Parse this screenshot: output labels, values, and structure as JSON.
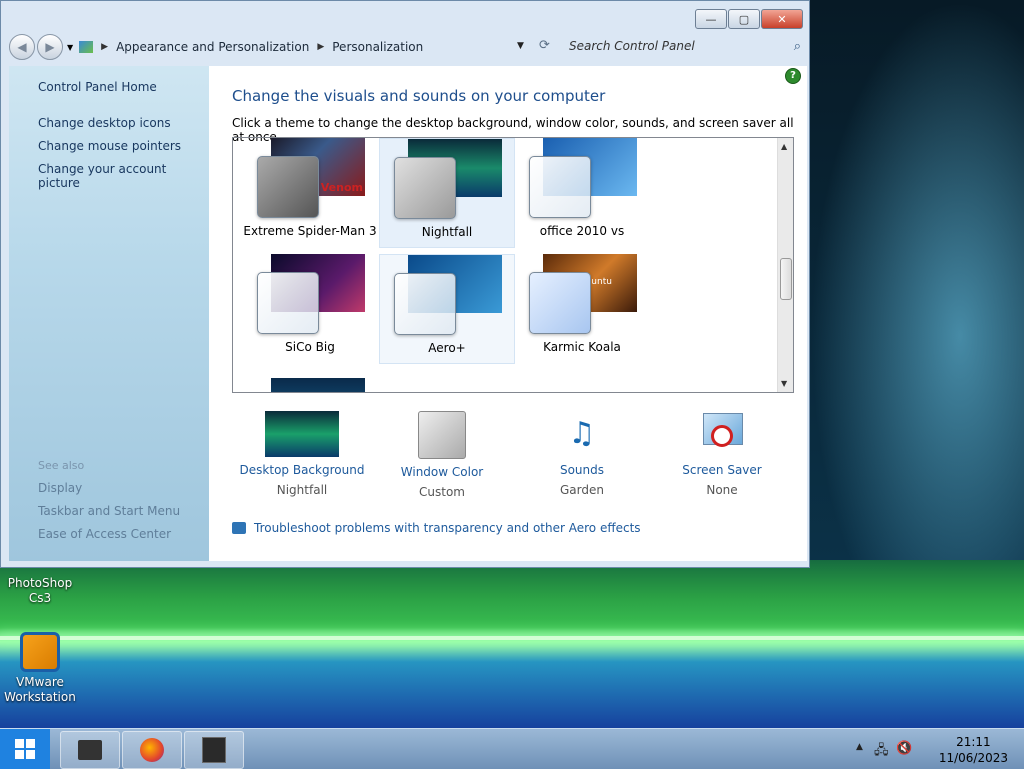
{
  "window": {
    "controls": {
      "minimize": "—",
      "maximize": "▢",
      "close": "✕"
    },
    "breadcrumb": [
      "Appearance and Personalization",
      "Personalization"
    ],
    "search_placeholder": "Search Control Panel"
  },
  "sidebar": {
    "home": "Control Panel Home",
    "links": [
      "Change desktop icons",
      "Change mouse pointers",
      "Change your account picture"
    ],
    "see_also_label": "See also",
    "see_also": [
      "Display",
      "Taskbar and Start Menu",
      "Ease of Access Center"
    ]
  },
  "main": {
    "heading": "Change the visuals and sounds on your computer",
    "subheading": "Click a theme to change the desktop background, window color, sounds, and screen saver all at once.",
    "themes": [
      "Extreme Spider-Man 3",
      "Nightfall",
      "office 2010 vs",
      "SiCo Big",
      "Aero+",
      "Karmic Koala"
    ],
    "selected_theme": "Nightfall",
    "thumb_text": {
      "venom": "Venom",
      "ubuntu": "Ubuntu"
    }
  },
  "settings": [
    {
      "label": "Desktop Background",
      "value": "Nightfall"
    },
    {
      "label": "Window Color",
      "value": "Custom"
    },
    {
      "label": "Sounds",
      "value": "Garden"
    },
    {
      "label": "Screen Saver",
      "value": "None"
    }
  ],
  "troubleshoot": "Troubleshoot problems with transparency and other Aero effects",
  "desktop_icons": [
    {
      "label": "PhotoShop Cs3"
    },
    {
      "label": "VMware Workstation"
    }
  ],
  "taskbar": {
    "time": "21:11",
    "date": "11/06/2023"
  },
  "colors": {
    "accent_link": "#1e5a9c",
    "heading": "#1e4e8c",
    "start_button": "#1f82e0"
  }
}
